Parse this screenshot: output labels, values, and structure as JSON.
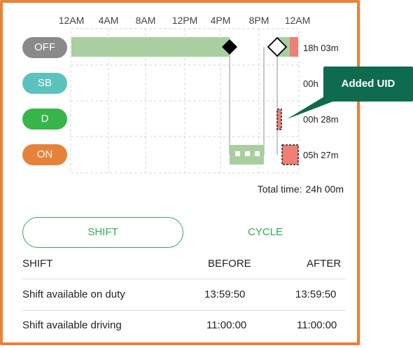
{
  "timeline": {
    "hour_labels": [
      "12AM",
      "4AM",
      "8AM",
      "12PM",
      "4PM",
      "8PM",
      "12AM"
    ],
    "statuses": [
      {
        "label": "OFF",
        "color": "#8A8A8A",
        "duration": "18h 03m"
      },
      {
        "label": "SB",
        "color": "#5BC2BD",
        "duration": "00h"
      },
      {
        "label": "D",
        "color": "#38B54A",
        "duration": "00h 28m"
      },
      {
        "label": "ON",
        "color": "#E8823A",
        "duration": "05h 27m"
      }
    ],
    "total_label": "Total time:",
    "total_value": "24h 00m"
  },
  "callout": {
    "label": "Added UID"
  },
  "toggle": {
    "shift_label": "SHIFT",
    "cycle_label": "CYCLE"
  },
  "table": {
    "headers": {
      "name": "SHIFT",
      "before": "BEFORE",
      "after": "AFTER"
    },
    "rows": [
      {
        "name": "Shift available on duty",
        "before": "13:59:50",
        "after": "13:59:50"
      },
      {
        "name": "Shift available driving",
        "before": "11:00:00",
        "after": "11:00:00"
      }
    ]
  },
  "colors": {
    "frame_border": "#E8823A",
    "off_segment": "#A9CFA0",
    "on_segment": "#A9CFA0",
    "edited_segment": "#EF7F77",
    "accent_green": "#2FAE55",
    "callout_bg": "#0E6B4E"
  }
}
